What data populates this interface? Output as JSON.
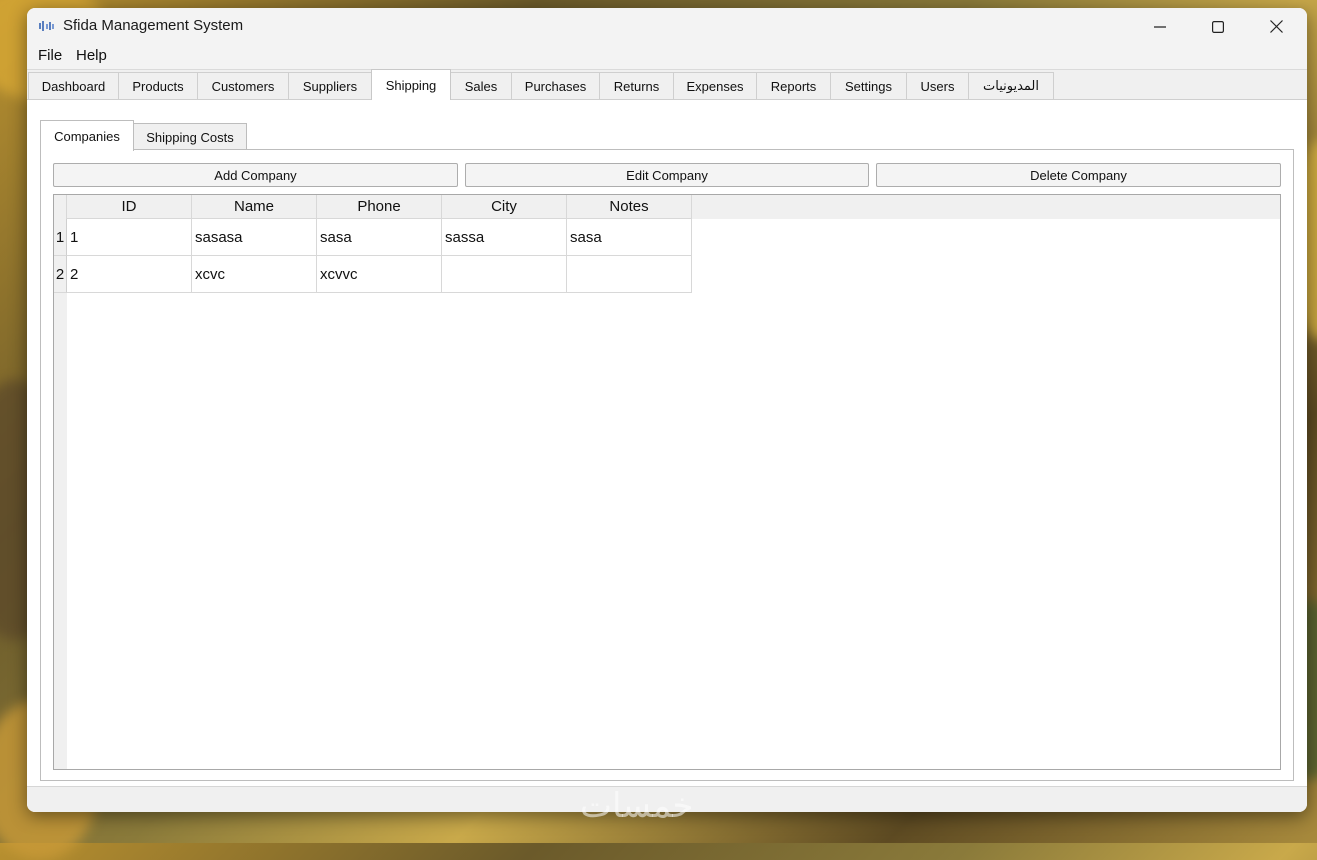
{
  "window": {
    "title": "Sfida Management System"
  },
  "menu": [
    "File",
    "Help"
  ],
  "tabs": [
    "Dashboard",
    "Products",
    "Customers",
    "Suppliers",
    "Shipping",
    "Sales",
    "Purchases",
    "Returns",
    "Expenses",
    "Reports",
    "Settings",
    "Users",
    "المديونيات"
  ],
  "active_tab": "Shipping",
  "subtabs": [
    "Companies",
    "Shipping Costs"
  ],
  "active_subtab": "Companies",
  "buttons": {
    "add": "Add Company",
    "edit": "Edit Company",
    "delete": "Delete Company"
  },
  "table": {
    "columns": [
      "ID",
      "Name",
      "Phone",
      "City",
      "Notes"
    ],
    "row_numbers": [
      "1",
      "2"
    ],
    "rows": [
      [
        "1",
        "sasasa",
        "sasa",
        "sassa",
        "sasa"
      ],
      [
        "2",
        "xcvc",
        "xcvvc",
        "",
        ""
      ]
    ]
  },
  "watermark": "خمسات"
}
